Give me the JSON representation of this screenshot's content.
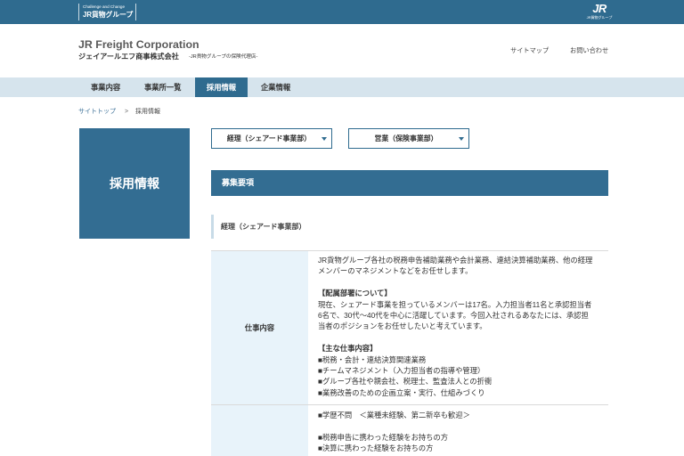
{
  "topbar": {
    "group_logo": {
      "tagline": "Challenge and Change",
      "name": "JR貨物グループ"
    },
    "jr_logo": {
      "mark": "JR",
      "text": "JR貨物グループ"
    }
  },
  "header": {
    "company_name_en": "JR Freight Corporation",
    "company_name_ja": "ジェイアールエフ商事株式会社",
    "company_tagline": "-JR貨物グループの保険代理店-",
    "links": [
      {
        "label": "サイトマップ"
      },
      {
        "label": "お問い合わせ"
      }
    ]
  },
  "nav": {
    "items": [
      {
        "label": "事業内容"
      },
      {
        "label": "事業所一覧"
      },
      {
        "label": "採用情報",
        "active": true
      },
      {
        "label": "企業情報"
      }
    ]
  },
  "breadcrumb": {
    "home": "サイトトップ",
    "separator": ">",
    "current": "採用情報"
  },
  "sidebar": {
    "title": "採用情報"
  },
  "main": {
    "job_selectors": [
      {
        "label": "経理（シェアード事業部）",
        "icon": "caret-down-icon"
      },
      {
        "label": "営業（保険事業部）",
        "icon": "caret-down-icon"
      }
    ],
    "section_title": "募集要項",
    "job_title": "経理（シェアード事業部）",
    "requirements": [
      {
        "label": "仕事内容",
        "paragraphs": [
          [
            "JR貨物グループ各社の税務申告補助業務や会計業務、連結決算補助業務、他の経理",
            "メンバーのマネジメントなどをお任せします。"
          ],
          [
            "【配属部署について】",
            "現在、シェアード事業を担っているメンバーは17名。入力担当者11名と承認担当者",
            "6名で、30代〜40代を中心に活躍しています。今回入社されるあなたには、承認担",
            "当者のポジションをお任せしたいと考えています。"
          ],
          [
            "【主な仕事内容】",
            "■税務・会計・連結決算関連業務",
            "■チームマネジメント（入力担当者の指導や管理）",
            "■グループ各社や親会社、税理士、監査法人との折衝",
            "■業務改善のための企画立案・実行、仕組みづくり"
          ]
        ]
      },
      {
        "paragraphs": [
          [
            "■学歴不問　＜業種未経験、第二新卒も歓迎＞"
          ],
          [
            "■税務申告に携わった経験をお持ちの方",
            "■決算に携わった経験をお持ちの方"
          ]
        ]
      }
    ]
  },
  "colors": {
    "primary": "#2f6b8f",
    "nav_background": "#d6e4ed",
    "label_cell_background": "#e8f3fa",
    "link": "#3d7198"
  }
}
